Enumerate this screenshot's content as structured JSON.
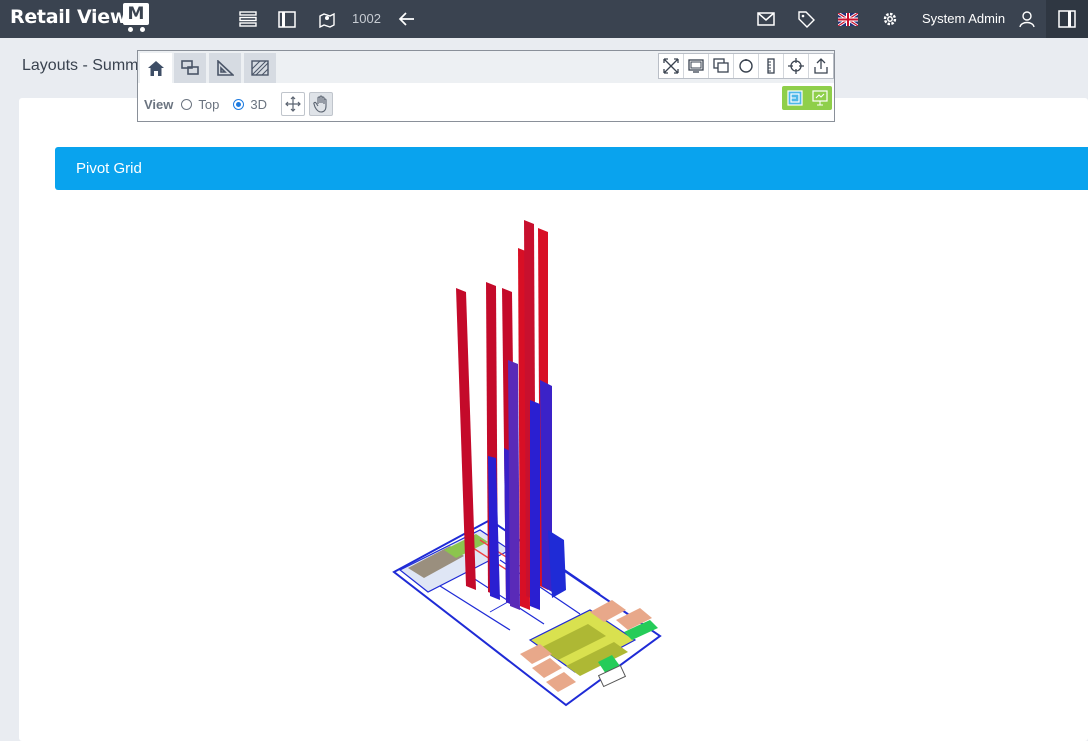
{
  "app": {
    "logo_text": "Retail Viewer",
    "logo_mark": "M"
  },
  "topbar": {
    "layout_id": "1002",
    "user_name": "System Admin",
    "icons": [
      "list-icon",
      "columns-icon",
      "map-icon",
      "arrow-left-icon",
      "mail-icon",
      "tag-icon",
      "flag-uk-icon",
      "gear-icon",
      "user-icon",
      "panel-toggle-icon"
    ]
  },
  "page": {
    "title": "Layouts - Summ"
  },
  "toolbar": {
    "tabs": [
      "home-icon",
      "layers-icon",
      "set-square-icon",
      "hatch-icon"
    ],
    "tools": [
      "expand-icon",
      "monitor-icon",
      "window-icon",
      "circle-icon",
      "ruler-icon",
      "crosshair-icon",
      "export-icon"
    ],
    "view_label": "View",
    "view_options": [
      {
        "label": "Top",
        "selected": false
      },
      {
        "label": "3D",
        "selected": true
      }
    ]
  },
  "pivot": {
    "title": "Pivot Grid"
  },
  "colors": {
    "accent": "#09a3ee",
    "bar_red": "#d3122c",
    "bar_blue": "#2a1fd1",
    "nav": "#3a4350"
  }
}
